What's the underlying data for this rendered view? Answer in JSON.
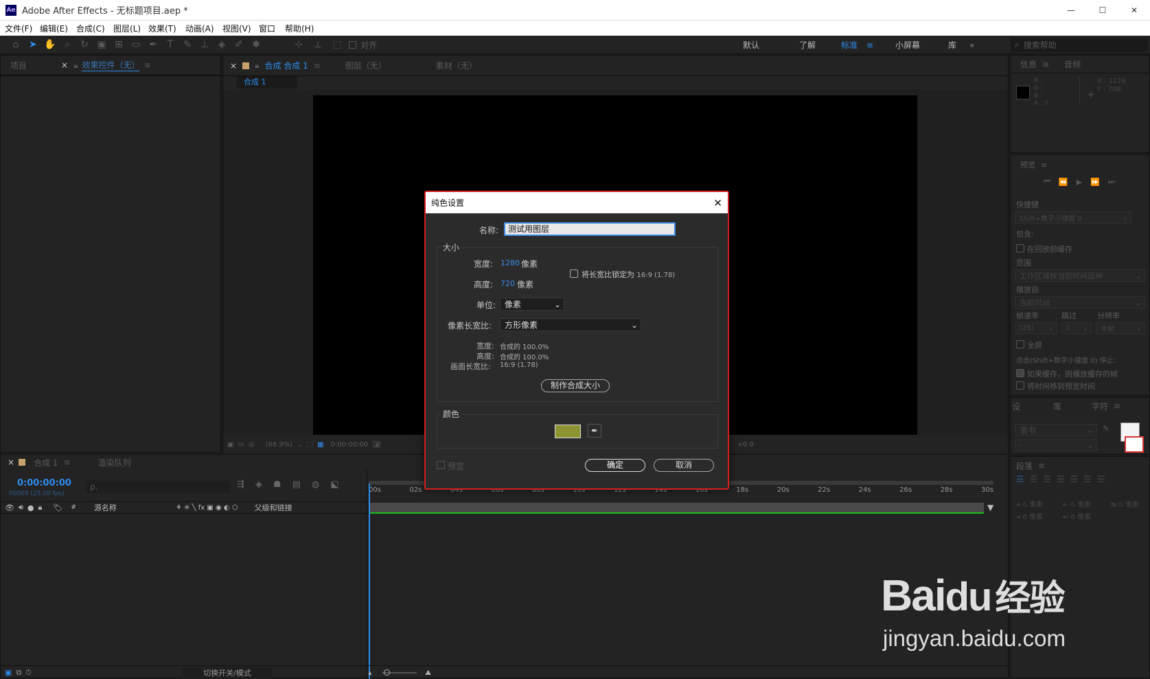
{
  "app": {
    "title": "Adobe After Effects - 无标题项目.aep *",
    "logo": "Ae"
  },
  "window_controls": [
    "—",
    "☐",
    "✕"
  ],
  "menu": [
    "文件(F)",
    "编辑(E)",
    "合成(C)",
    "图层(L)",
    "效果(T)",
    "动画(A)",
    "视图(V)",
    "窗口",
    "帮助(H)"
  ],
  "toolbar": {
    "align_label": "对齐",
    "workspaces": [
      "默认",
      "了解",
      "标准",
      "小屏幕",
      "库"
    ],
    "active_workspace": "标准",
    "search_placeholder": "搜索帮助"
  },
  "project_panel": {
    "tab_project": "项目",
    "tab_effects": "效果控件（无）"
  },
  "comp_panel": {
    "tab_comp": "合成 合成 1",
    "tab_layer": "图层（无）",
    "tab_footage": "素材（无）",
    "breadcrumb": "合成 1",
    "zoom": "(68.9%)",
    "time": "0:00:00:00",
    "offset": "+0.0"
  },
  "info_panel": {
    "tab_info": "信息",
    "tab_audio": "音频",
    "r": "R :",
    "g": "G :",
    "b": "B :",
    "a": "A : 0",
    "x": "X : 1226",
    "y": "Y : 706"
  },
  "preview_panel": {
    "title": "预览",
    "shortcut_label": "快捷键",
    "shortcut_value": "Shift+数字小键盘 0",
    "include_label": "包含:",
    "cache_label": "在回放前缓存",
    "range_label": "范围",
    "range_value": "工作区域按当前时间延伸",
    "play_from_label": "播放自",
    "play_from_value": "当前时间",
    "fps_label": "帧速率",
    "skip_label": "跳过",
    "res_label": "分辨率",
    "fps_value": "(25)",
    "skip_value": "1",
    "res_value": "半帧",
    "fullscreen_label": "全屏",
    "stop_label": "点击(Shift+数字小键盘 0) 停止：",
    "if_cached_label": "如果缓存，则播放缓存的帧",
    "move_time_label": "将时间移到预览时间"
  },
  "char_panel": {
    "tab1": "设",
    "tab2": "库",
    "tab3": "字符",
    "font_value": "隶书",
    "style_value": "-"
  },
  "para_panel": {
    "title": "段落",
    "indent1": "0 像素",
    "indent2": "0 像素",
    "indent3": "0 像素",
    "indent4": "0 像素",
    "indent5": "0 像素"
  },
  "timeline": {
    "tab_comp": "合成 1",
    "tab_render": "渲染队列",
    "timecode": "0:00:00:00",
    "frames": "00000 (25.00 fps)",
    "search_placeholder": "ρ.",
    "col_hash": "#",
    "col_source": "源名称",
    "col_parent": "父级和链接",
    "ruler": [
      "00s",
      "02s",
      "04s",
      "06s",
      "08s",
      "10s",
      "12s",
      "14s",
      "16s",
      "18s",
      "20s",
      "22s",
      "24s",
      "26s",
      "28s",
      "30s"
    ],
    "toggle_label": "切换开关/模式"
  },
  "dialog": {
    "title": "纯色设置",
    "name_label": "名称:",
    "name_value": "测试用图层",
    "size_group": "大小",
    "width_label": "宽度:",
    "width_value": "1280",
    "width_unit": "像素",
    "height_label": "高度:",
    "height_value": "720",
    "height_unit": "像素",
    "lock_label": "将长宽比锁定为",
    "lock_ratio": "16:9 (1.78)",
    "unit_label": "单位:",
    "unit_value": "像素",
    "par_label": "像素长宽比:",
    "par_value": "方形像素",
    "info_w_label": "宽度:",
    "info_w_value": "合成的 100.0%",
    "info_h_label": "高度:",
    "info_h_value": "合成的 100.0%",
    "info_ar_label": "画面长宽比:",
    "info_ar_value": "16:9 (1.78)",
    "make_comp_size": "制作合成大小",
    "color_group": "颜色",
    "swatch_color": "#8f9433",
    "preview_label": "预览",
    "ok": "确定",
    "cancel": "取消"
  },
  "watermark": {
    "brand": "Bai",
    "paw": "du",
    "suffix": "经验",
    "url": "jingyan.baidu.com"
  }
}
